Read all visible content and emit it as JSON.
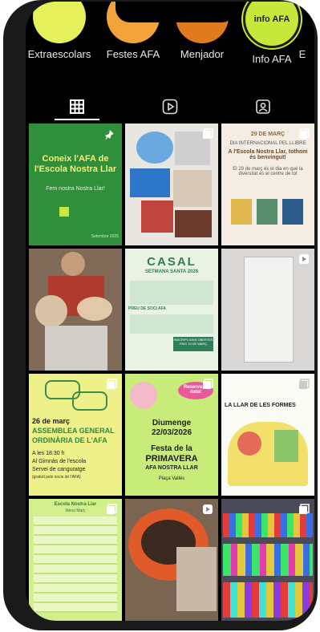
{
  "highlights": [
    {
      "label": "Extraescolars",
      "circle_text": "",
      "color": "#e6f05a"
    },
    {
      "label": "Festes AFA",
      "circle_text": "",
      "color": "#f2a33a"
    },
    {
      "label": "Menjador",
      "circle_text": "",
      "color": "#e07a1e"
    },
    {
      "label": "Info AFA",
      "circle_text": "info AFA",
      "color": "#c6e83a"
    },
    {
      "label": "E",
      "circle_text": "",
      "color": "#888888"
    }
  ],
  "tabs": [
    {
      "name": "grid-tab",
      "icon": "grid-icon"
    },
    {
      "name": "reels-tab",
      "icon": "reels-icon"
    },
    {
      "name": "tagged-tab",
      "icon": "tagged-icon"
    }
  ],
  "posts": {
    "p1": {
      "title": "Coneix l'AFA de l'Escola Nostra Llar",
      "subtitle": "Fem nostra Nostra Llar!",
      "date": "Setembre 2025"
    },
    "p2": {
      "caption": ""
    },
    "p3": {
      "heading": "29 DE MARÇ",
      "line1": "DIA INTERNACIONAL PEL LLIBRE",
      "line2": "A l'Escola Nostra Llar, tothom és benvingut!",
      "body": "El 29 de març és el dia en què la diversitat és el centre de tot"
    },
    "p4": {
      "caption": ""
    },
    "p5": {
      "title": "CASAL",
      "subtitle": "SETMANA SANTA 2026",
      "price_label": "PREU DE SOCI AFA",
      "note": "INSCRIPCIONS OBERTES FINS 19 DE MARÇ"
    },
    "p6": {
      "caption": ""
    },
    "p7": {
      "date": "26 de març",
      "title1": "ASSEMBLEA GENERAL",
      "title2": "ORDINÀRIA DE L'AFA",
      "time": "A les 18:30 h",
      "place": "Al Gimnàs de l'escola",
      "service": "Servei de canguratge",
      "note": "(gratuït pels socis de l'AFA)"
    },
    "p8": {
      "badge": "Reserva la data!",
      "day": "Diumenge",
      "date": "22/03/2026",
      "title1": "Festa de la",
      "title2": "PRIMAVERA",
      "org": "AFA NOSTRA LLAR",
      "place": "Plaça Vallès"
    },
    "p9": {
      "title": "LA LLAR DE LES FORMES"
    },
    "p10": {
      "title": "Escola Nostra Llar",
      "sub": "Menú Març"
    },
    "p11": {
      "caption": ""
    },
    "p12": {
      "caption": ""
    }
  }
}
